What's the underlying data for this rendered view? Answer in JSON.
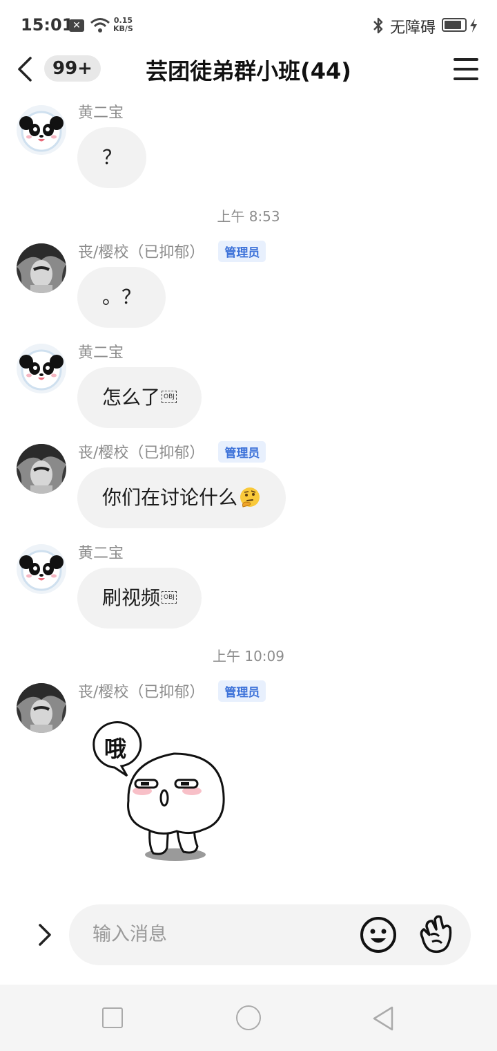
{
  "status_bar": {
    "time": "15:01",
    "net_speed": "0.15",
    "net_unit": "KB/S",
    "accessibility": "无障碍",
    "battery_level": 0.85
  },
  "header": {
    "unread_badge": "99+",
    "title": "芸团徒弟群小班(44)"
  },
  "messages": [
    {
      "sender": "黄二宝",
      "text": "？",
      "admin": false
    },
    {
      "sender": "丧/樱校（已抑郁）",
      "text": "。？",
      "admin": true,
      "admin_label": "管理员"
    },
    {
      "sender": "黄二宝",
      "text": "怎么了",
      "admin": false
    },
    {
      "sender": "丧/樱校（已抑郁）",
      "text": "你们在讨论什么",
      "admin": true,
      "admin_label": "管理员"
    },
    {
      "sender": "黄二宝",
      "text": "刷视频",
      "admin": false
    },
    {
      "sender": "丧/樱校（已抑郁）",
      "admin": true,
      "admin_label": "管理员",
      "sticker_text": "哦"
    }
  ],
  "timestamps": [
    "上午 8:53",
    "上午 10:09"
  ],
  "input": {
    "placeholder": "输入消息"
  },
  "obj_marker": "OBJ",
  "colors": {
    "admin_tag_bg": "#e8f0fd",
    "admin_tag_text": "#3d72d9",
    "bubble_bg": "#f2f2f2"
  }
}
